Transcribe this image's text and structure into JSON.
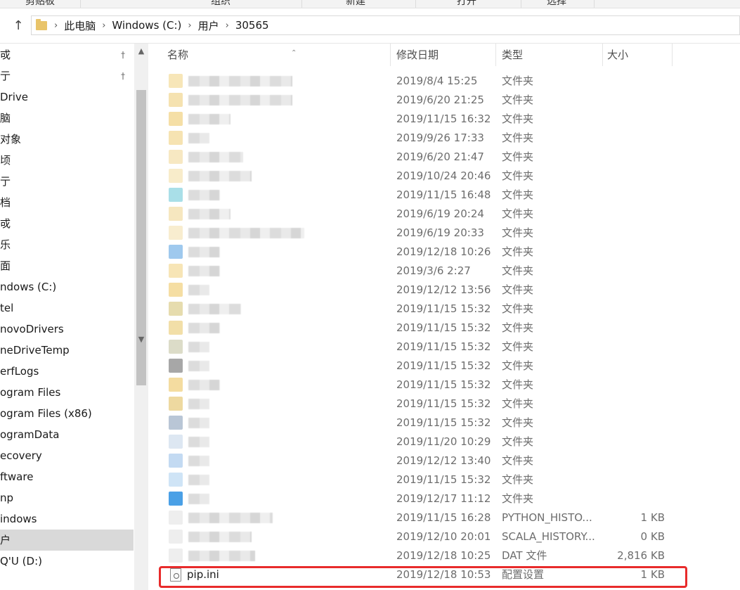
{
  "ribbon": {
    "groups": [
      "剪贴板",
      "组织",
      "新建",
      "打开",
      "选择"
    ]
  },
  "address": {
    "up_icon": "up-arrow-icon",
    "crumbs": [
      "此电脑",
      "Windows (C:)",
      "用户",
      "30565"
    ]
  },
  "nav": {
    "items": [
      {
        "label": "戓",
        "pinned": true
      },
      {
        "label": "亍",
        "pinned": true
      },
      {
        "label": "Drive",
        "pinned": false
      },
      {
        "label": "脑",
        "pinned": false
      },
      {
        "label": "对象",
        "pinned": false
      },
      {
        "label": "顷",
        "pinned": false
      },
      {
        "label": "亍",
        "pinned": false
      },
      {
        "label": "档",
        "pinned": false
      },
      {
        "label": "戓",
        "pinned": false
      },
      {
        "label": "乐",
        "pinned": false
      },
      {
        "label": "面",
        "pinned": false
      },
      {
        "label": "ndows (C:)",
        "pinned": false
      },
      {
        "label": "tel",
        "pinned": false
      },
      {
        "label": "novoDrivers",
        "pinned": false
      },
      {
        "label": "neDriveTemp",
        "pinned": false
      },
      {
        "label": "erfLogs",
        "pinned": false
      },
      {
        "label": "ogram Files",
        "pinned": false
      },
      {
        "label": "ogram Files (x86)",
        "pinned": false
      },
      {
        "label": "ogramData",
        "pinned": false
      },
      {
        "label": "ecovery",
        "pinned": false
      },
      {
        "label": "ftware",
        "pinned": false
      },
      {
        "label": "np",
        "pinned": false
      },
      {
        "label": "indows",
        "pinned": false
      },
      {
        "label": "户",
        "pinned": false,
        "selected": true
      },
      {
        "label": "Q'U (D:)",
        "pinned": false
      }
    ]
  },
  "columns": {
    "name": "名称",
    "date": "修改日期",
    "type": "类型",
    "size": "大小"
  },
  "files": [
    {
      "date": "2019/8/4 15:25",
      "type": "文件夹",
      "size": "",
      "color": "#f7e6b8"
    },
    {
      "date": "2019/6/20 21:25",
      "type": "文件夹",
      "size": "",
      "color": "#f5e2b0"
    },
    {
      "date": "2019/11/15 16:32",
      "type": "文件夹",
      "size": "",
      "color": "#f5dfa6"
    },
    {
      "date": "2019/9/26 17:33",
      "type": "文件夹",
      "size": "",
      "color": "#f6e3b2"
    },
    {
      "date": "2019/6/20 21:47",
      "type": "文件夹",
      "size": "",
      "color": "#f7e8c2"
    },
    {
      "date": "2019/10/24 20:46",
      "type": "文件夹",
      "size": "",
      "color": "#f8ecca"
    },
    {
      "date": "2019/11/15 16:48",
      "type": "文件夹",
      "size": "",
      "color": "#a9dfe8"
    },
    {
      "date": "2019/6/19 20:24",
      "type": "文件夹",
      "size": "",
      "color": "#f6e7bf"
    },
    {
      "date": "2019/6/19 20:33",
      "type": "文件夹",
      "size": "",
      "color": "#f8edcf"
    },
    {
      "date": "2019/12/18 10:26",
      "type": "文件夹",
      "size": "",
      "color": "#9fc9ee"
    },
    {
      "date": "2019/3/6 2:27",
      "type": "文件夹",
      "size": "",
      "color": "#f7e5b6"
    },
    {
      "date": "2019/12/12 13:56",
      "type": "文件夹",
      "size": "",
      "color": "#f5dea3"
    },
    {
      "date": "2019/11/15 15:32",
      "type": "文件夹",
      "size": "",
      "color": "#e6dcae"
    },
    {
      "date": "2019/11/15 15:32",
      "type": "文件夹",
      "size": "",
      "color": "#f2dfa8"
    },
    {
      "date": "2019/11/15 15:32",
      "type": "文件夹",
      "size": "",
      "color": "#dcdcc8"
    },
    {
      "date": "2019/11/15 15:32",
      "type": "文件夹",
      "size": "",
      "color": "#a7a7a7"
    },
    {
      "date": "2019/11/15 15:32",
      "type": "文件夹",
      "size": "",
      "color": "#f4dca0"
    },
    {
      "date": "2019/11/15 15:32",
      "type": "文件夹",
      "size": "",
      "color": "#eed9a0"
    },
    {
      "date": "2019/11/15 15:32",
      "type": "文件夹",
      "size": "",
      "color": "#b9c6d6"
    },
    {
      "date": "2019/11/20 10:29",
      "type": "文件夹",
      "size": "",
      "color": "#dde7f2"
    },
    {
      "date": "2019/12/12 13:40",
      "type": "文件夹",
      "size": "",
      "color": "#c3daf2"
    },
    {
      "date": "2019/11/15 15:32",
      "type": "文件夹",
      "size": "",
      "color": "#cfe4f6"
    },
    {
      "date": "2019/12/17 11:12",
      "type": "文件夹",
      "size": "",
      "color": "#4aa0e6"
    },
    {
      "date": "2019/11/15 16:28",
      "type": "PYTHON_HISTO...",
      "size": "1 KB",
      "color": "#eeeeee"
    },
    {
      "date": "2019/12/10 20:01",
      "type": "SCALA_HISTORY...",
      "size": "0 KB",
      "color": "#eeeeee"
    },
    {
      "date": "2019/12/18 10:25",
      "type": "DAT 文件",
      "size": "2,816 KB",
      "color": "#eeeeee"
    }
  ],
  "highlighted_file": {
    "name": "pip.ini",
    "date": "2019/12/18 10:53",
    "type": "配置设置",
    "size": "1 KB",
    "icon": "ini-file-icon"
  },
  "highlight_color": "#e82b2b"
}
